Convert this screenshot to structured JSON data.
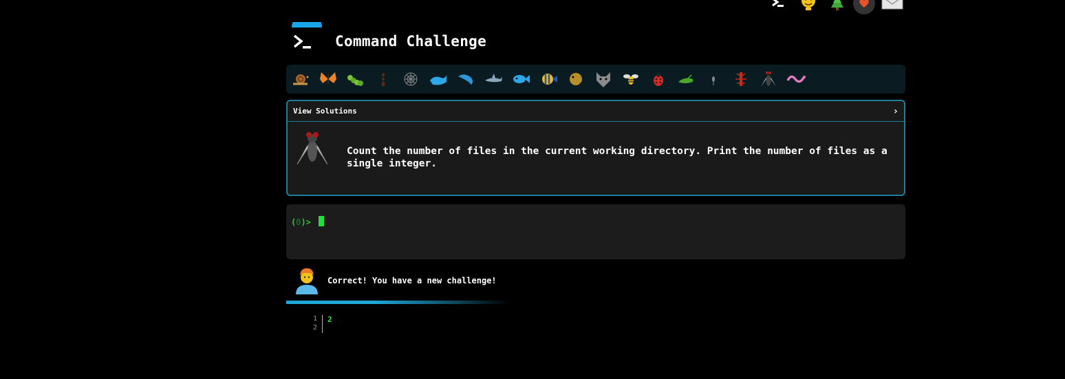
{
  "header": {
    "title": "Command Challenge",
    "logo_icon": "terminal-prompt-icon"
  },
  "top_nav": [
    {
      "icon": "terminal-icon",
      "name": "terminal"
    },
    {
      "icon": "lightbulb-face-icon",
      "name": "hint"
    },
    {
      "icon": "tree-icon",
      "name": "tree"
    },
    {
      "icon": "heart-icon",
      "name": "heart"
    },
    {
      "icon": "envelope-icon",
      "name": "mail"
    }
  ],
  "challenges": [
    "snail-icon",
    "butterfly-icon",
    "caterpillar-icon",
    "ant-icon",
    "spider-web-icon",
    "whale-icon",
    "dolphin-icon",
    "shark-icon",
    "fish-icon",
    "tropical-fish-icon",
    "blowfish-icon",
    "wolf-icon",
    "bee-icon",
    "ladybug-icon",
    "cricket-icon",
    "mosquito-icon",
    "scorpion-icon",
    "fly-icon",
    "worm-icon"
  ],
  "card": {
    "header_label": "View Solutions",
    "chevron": "›",
    "icon": "fly-icon",
    "description": "Count the number of files in the current working directory. Print the number of files as a single integer."
  },
  "terminal": {
    "prompt_open": "(",
    "prompt_count": "0",
    "prompt_close": ")>"
  },
  "status": {
    "avatar_icon": "person-curly-hair-icon",
    "message": "Correct! You have a new challenge!",
    "progress": 0.6
  },
  "output": {
    "line_numbers": [
      "1",
      "2"
    ],
    "lines": [
      "2",
      ""
    ]
  },
  "colors": {
    "accent": "#1da6d6",
    "terminal_green": "#2ee23f",
    "card_border": "#1e7f9a"
  }
}
